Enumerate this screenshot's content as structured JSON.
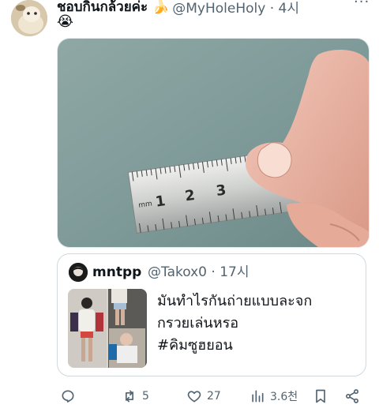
{
  "tweet": {
    "display_name": "ชอบกินกล้วยค่ะ 🍌",
    "handle": "@MyHoleHoly · 4시",
    "more_icon": "more-dots-icon",
    "body_emoji": "😭"
  },
  "quote": {
    "name": "mntpp",
    "handle": "@Takox0 · 17시",
    "text": "มันทำไรกันถ่ายแบบละจก\nกรวยเล่นหรอ\n#คิมซูฮยอน"
  },
  "actions": {
    "reply_icon": "reply-icon",
    "retweet_icon": "retweet-icon",
    "retweets": "5",
    "like_icon": "heart-icon",
    "likes": "27",
    "views_icon": "views-icon",
    "views": "3.6천",
    "bookmark_icon": "bookmark-icon",
    "share_icon": "share-icon"
  },
  "ruler": {
    "unit_label": "mm",
    "numbers": [
      "1",
      "2",
      "3"
    ]
  }
}
